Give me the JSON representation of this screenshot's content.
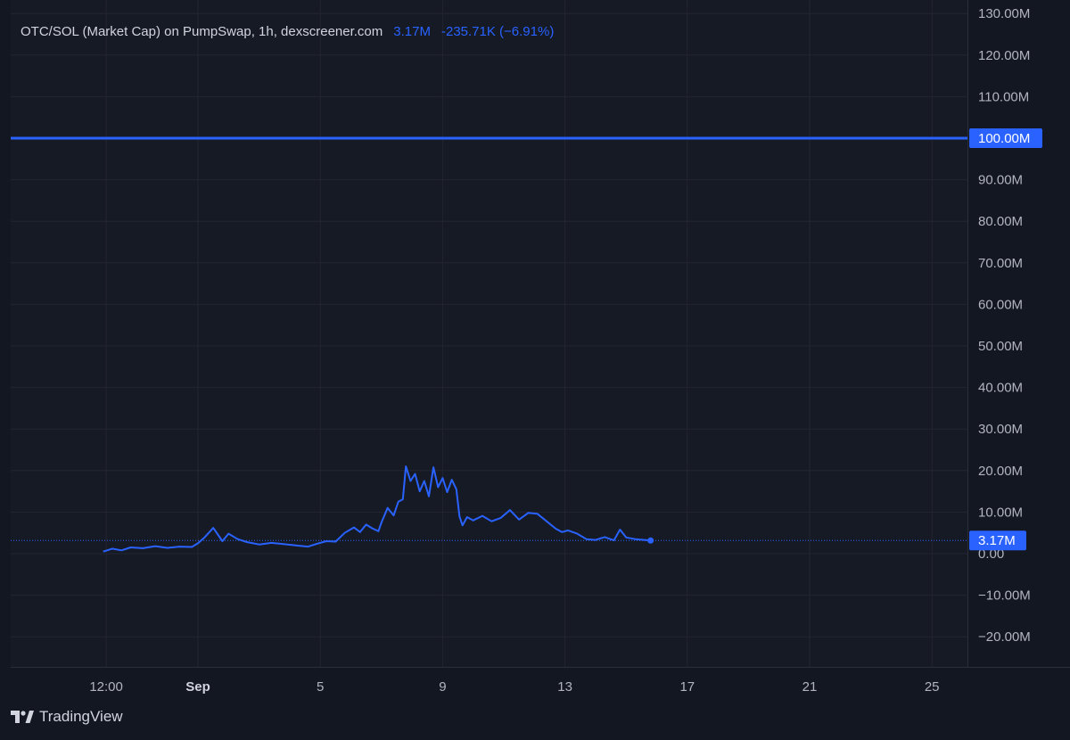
{
  "header": {
    "title": "OTC/SOL (Market Cap) on PumpSwap, 1h, dexscreener.com",
    "last_value": "3.17M",
    "change": "-235.71K (−6.91%)"
  },
  "footer": {
    "brand": "TradingView",
    "logo_icon": "tradingview-logo-icon"
  },
  "colors": {
    "line": "#2962ff",
    "background": "#161a25",
    "grid": "#232632",
    "axis_text": "#b2b5be"
  },
  "chart_data": {
    "type": "line",
    "title": "OTC/SOL (Market Cap) on PumpSwap, 1h, dexscreener.com",
    "xlabel": "",
    "ylabel": "",
    "unit": "M",
    "ylim": [
      -25,
      130
    ],
    "y_ticks": [
      -20,
      -10,
      0,
      10,
      20,
      30,
      40,
      50,
      60,
      70,
      80,
      90,
      100,
      110,
      120,
      130
    ],
    "y_tick_labels": [
      "−20.00M",
      "−10.00M",
      "0.00",
      "10.00M",
      "20.00M",
      "30.00M",
      "40.00M",
      "50.00M",
      "60.00M",
      "70.00M",
      "80.00M",
      "90.00M",
      "100.00M",
      "110.00M",
      "120.00M",
      "130.00M"
    ],
    "x_tick_labels": [
      "12:00",
      "Sep",
      "5",
      "9",
      "13",
      "17",
      "21",
      "25"
    ],
    "x_tick_values": [
      -2,
      1,
      5,
      9,
      13,
      17,
      21,
      25
    ],
    "xlim": [
      -3.0,
      26.5
    ],
    "grid": true,
    "horizontal_line": {
      "value": 100,
      "label": "100.00M"
    },
    "last_price": {
      "value": 3.17,
      "label": "3.17M",
      "x": 15.8
    },
    "series": [
      {
        "x": [
          -2.1,
          -1.8,
          -1.5,
          -1.2,
          -0.8,
          -0.4,
          0.0,
          0.4,
          0.8,
          1.0,
          1.2,
          1.5,
          1.8,
          2.0,
          2.3,
          2.6,
          3.0,
          3.4,
          3.8,
          4.2,
          4.6,
          4.9,
          5.2,
          5.5,
          5.8,
          6.1,
          6.3,
          6.5,
          6.7,
          6.9,
          7.0,
          7.2,
          7.4,
          7.55,
          7.7,
          7.8,
          7.95,
          8.1,
          8.25,
          8.4,
          8.55,
          8.7,
          8.85,
          9.0,
          9.15,
          9.3,
          9.45,
          9.55,
          9.65,
          9.8,
          10.0,
          10.3,
          10.6,
          10.9,
          11.2,
          11.5,
          11.8,
          12.1,
          12.4,
          12.7,
          12.9,
          13.1,
          13.4,
          13.7,
          14.0,
          14.3,
          14.6,
          14.8,
          15.0,
          15.3,
          15.6,
          15.8
        ],
        "y": [
          0.5,
          1.2,
          0.8,
          1.5,
          1.3,
          1.8,
          1.4,
          1.7,
          1.6,
          2.5,
          3.8,
          6.2,
          3.0,
          4.8,
          3.5,
          2.8,
          2.2,
          2.6,
          2.3,
          2.0,
          1.7,
          2.4,
          3.0,
          2.9,
          5.0,
          6.3,
          5.2,
          7.0,
          6.1,
          5.4,
          7.5,
          11.0,
          9.2,
          12.5,
          13.1,
          21.0,
          17.5,
          19.2,
          15.0,
          17.5,
          13.8,
          20.8,
          16.0,
          18.2,
          14.8,
          17.8,
          15.5,
          9.0,
          6.8,
          8.8,
          8.0,
          9.1,
          7.8,
          8.6,
          10.5,
          8.2,
          9.8,
          9.6,
          7.8,
          6.0,
          5.2,
          5.6,
          4.8,
          3.5,
          3.3,
          4.0,
          3.2,
          5.8,
          3.9,
          3.5,
          3.3,
          3.17
        ]
      }
    ]
  }
}
